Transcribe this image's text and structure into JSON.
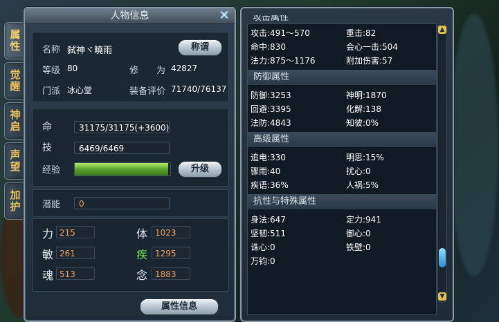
{
  "side_tabs": [
    "属性",
    "觉醒",
    "神启",
    "声望",
    "加护"
  ],
  "char_panel": {
    "title": "人物信息",
    "close_glyph": "✕",
    "info": {
      "name_label": "名称",
      "name_value": "弑神ヾ曉雨",
      "title_button": "称谓",
      "level_label": "等级",
      "level_value": "80",
      "cultivation_label": "修　　为",
      "cultivation_value": "42827",
      "sect_label": "门派",
      "sect_value": "冰心堂",
      "equip_label": "装备评价",
      "equip_value": "71740/76137"
    },
    "vitals": {
      "hp_label": "命",
      "hp_value": "31175/31175(+3600)",
      "skill_label": "技",
      "skill_value": "6469/6469",
      "exp_label": "经验",
      "exp_fill": 0.98,
      "upgrade_button": "升级"
    },
    "potential": {
      "label": "潜能",
      "value": "0"
    },
    "stats": [
      {
        "label": "力",
        "value": "215"
      },
      {
        "label": "体",
        "value": "1023"
      },
      {
        "label": "敏",
        "value": "261"
      },
      {
        "label": "疾",
        "value": "1295"
      },
      {
        "label": "魂",
        "value": "513"
      },
      {
        "label": "念",
        "value": "1883"
      }
    ],
    "footer_button": "属性信息"
  },
  "attr_panel": {
    "top_partial_header": "攻击属性",
    "attack": [
      {
        "k": "攻击:491～570",
        "v": "重击:82"
      },
      {
        "k": "命中:830",
        "v": "会心一击:504"
      },
      {
        "k": "法力:875～1176",
        "v": "附加伤害:57"
      }
    ],
    "defense_title": "防御属性",
    "defense": [
      {
        "k": "防御:3253",
        "v": "神明:1870"
      },
      {
        "k": "回避:3395",
        "v": "化解:138"
      },
      {
        "k": "法防:4843",
        "v": "知彼:0%"
      }
    ],
    "advanced_title": "高级属性",
    "advanced": [
      {
        "k": "追电:330",
        "v": "明思:15%"
      },
      {
        "k": "骤雨:40",
        "v": "扰心:0"
      },
      {
        "k": "疾语:36%",
        "v": "人祸:5%"
      }
    ],
    "resist_title": "抗性与特殊属性",
    "resist": [
      {
        "k": "身法:647",
        "v": "定力:941"
      },
      {
        "k": "坚韧:511",
        "v": "御心:0"
      },
      {
        "k": "诛心:0",
        "v": "铁壁:0"
      },
      {
        "k": "万钧:0",
        "v": ""
      }
    ],
    "scroll_position": 0.9
  }
}
